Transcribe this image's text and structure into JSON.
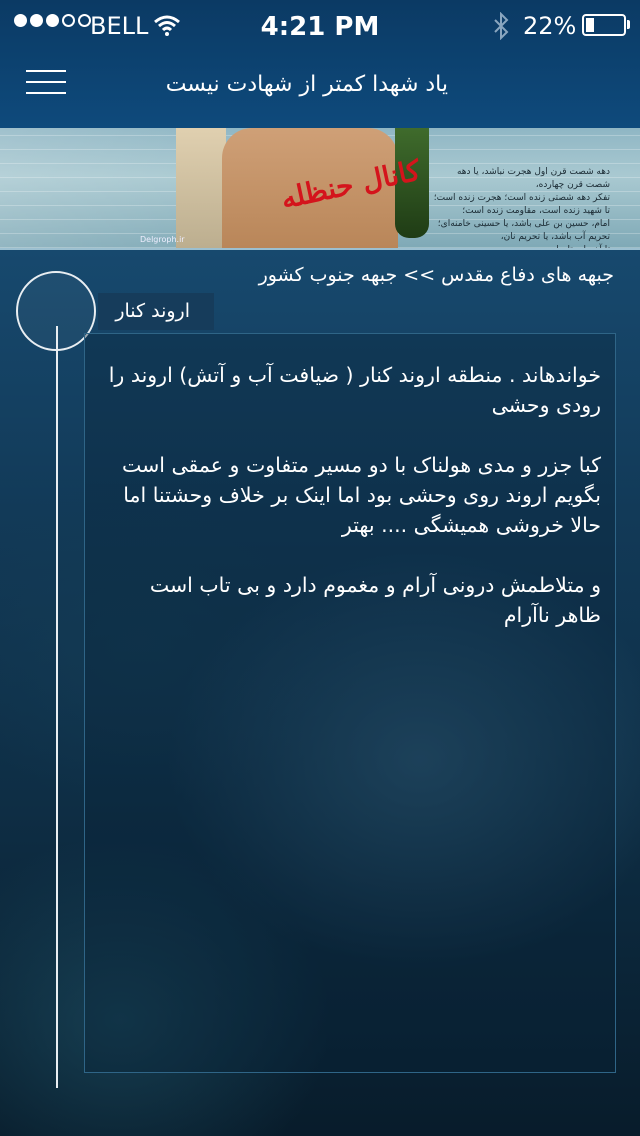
{
  "status_bar": {
    "carrier": "BELL",
    "time": "4:21 PM",
    "battery_percent": "22%",
    "battery_level": 0.22,
    "signal_bars_filled": 3,
    "signal_bars_total": 5
  },
  "nav": {
    "title": "یاد شهدا کمتر از شهادت نیست"
  },
  "banner": {
    "script_text": "کانال حنظله",
    "text_lines": [
      "دهه شصت قرن اول هجرت نباشد، یا دهه شصت قرن چهارده،",
      "تفکر دهه شصتی زنده است؛ هجرت زنده است؛",
      "تا شهید زنده است، مقاومت زنده است؛",
      "امام، حسین بن علی باشد، یا حسینی خامنه‌ای؛",
      "تحریم آب باشد، یا تحریم نان،",
      "تا آخر ایستاده‌ایم."
    ],
    "credit": "Delgroph.ir"
  },
  "breadcrumb": "جبهه های دفاع مقدس >>  جبهه جنوب کشور",
  "entry": {
    "tag": "اروند کنار",
    "paragraphs": [
      "خواندهاند . منطقه اروند کنار ( ضیافت آب و آتش) اروند را رودی وحشی",
      "کبا جزر و مدی هولناک با دو مسیر متفاوت و عمقی است بگویم اروند روی وحشی بود اما اینک بر خلاف وحشتنا اما حالا خروشی همیشگی .... بهتر",
      "و متلاطمش  درونی آرام و مغموم دارد و بی تاب است ظاهر ناآرام"
    ]
  },
  "colors": {
    "nav_background": "#0e4a7c",
    "card_border": "#2f6587",
    "tag_background": "#163c5b",
    "banner_script": "#d4141c"
  }
}
